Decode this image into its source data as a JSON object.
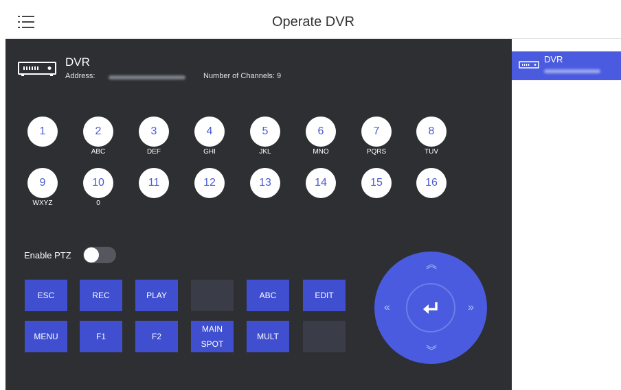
{
  "header": {
    "title": "Operate DVR"
  },
  "device": {
    "name": "DVR",
    "address_label": "Address:",
    "channels_label": "Number of Channels:",
    "channels_value": "9"
  },
  "channels": [
    {
      "num": "1",
      "letters": ""
    },
    {
      "num": "2",
      "letters": "ABC"
    },
    {
      "num": "3",
      "letters": "DEF"
    },
    {
      "num": "4",
      "letters": "GHI"
    },
    {
      "num": "5",
      "letters": "JKL"
    },
    {
      "num": "6",
      "letters": "MNO"
    },
    {
      "num": "7",
      "letters": "PQRS"
    },
    {
      "num": "8",
      "letters": "TUV"
    },
    {
      "num": "9",
      "letters": "WXYZ"
    },
    {
      "num": "10",
      "letters": "0"
    },
    {
      "num": "11",
      "letters": ""
    },
    {
      "num": "12",
      "letters": ""
    },
    {
      "num": "13",
      "letters": ""
    },
    {
      "num": "14",
      "letters": ""
    },
    {
      "num": "15",
      "letters": ""
    },
    {
      "num": "16",
      "letters": ""
    }
  ],
  "ptz": {
    "label": "Enable PTZ",
    "enabled": false
  },
  "keys": {
    "esc": "ESC",
    "rec": "REC",
    "play": "PLAY",
    "abc": "ABC",
    "edit": "EDIT",
    "menu": "MENU",
    "f1": "F1",
    "f2": "F2",
    "main": "MAIN",
    "spot": "SPOT",
    "mult": "MULT"
  },
  "sidebar": {
    "device_name": "DVR"
  },
  "colors": {
    "accent": "#4a5be0",
    "panel": "#2e2f33",
    "button": "#3f4fcf"
  },
  "icons": [
    "menu-icon",
    "dvr-device-icon",
    "enter-icon",
    "arrow-up-icon",
    "arrow-down-icon",
    "arrow-left-icon",
    "arrow-right-icon"
  ]
}
